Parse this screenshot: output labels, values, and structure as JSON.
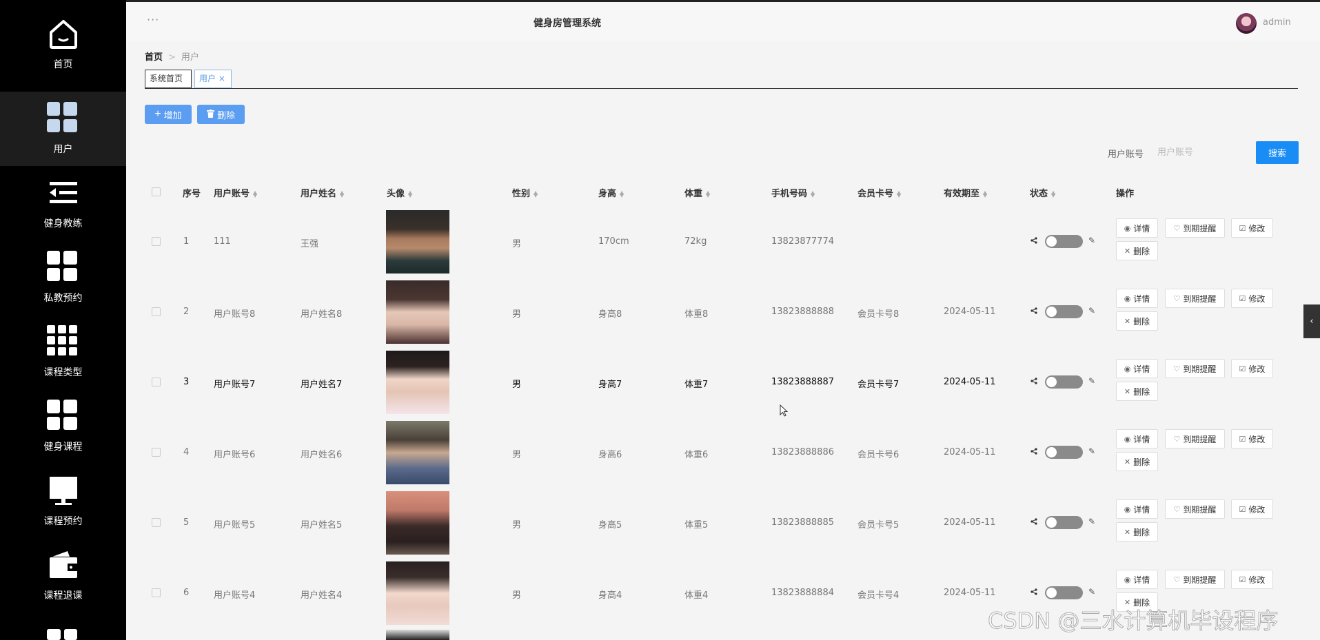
{
  "app": {
    "title": "健身房管理系统",
    "menu_dots": "···",
    "user": "admin"
  },
  "sidebar": {
    "items": [
      {
        "label": "首页",
        "icon": "home-icon"
      },
      {
        "label": "用户",
        "icon": "grid-icon",
        "active": true
      },
      {
        "label": "健身教练",
        "icon": "list-icon"
      },
      {
        "label": "私教预约",
        "icon": "grid-icon"
      },
      {
        "label": "课程类型",
        "icon": "grid9-icon"
      },
      {
        "label": "健身课程",
        "icon": "grid-icon"
      },
      {
        "label": "课程预约",
        "icon": "monitor-icon"
      },
      {
        "label": "课程退课",
        "icon": "wallet-icon"
      }
    ]
  },
  "breadcrumb": {
    "home": "首页",
    "sep": ">",
    "current": "用户"
  },
  "tabs": [
    {
      "label": "系统首页"
    },
    {
      "label": "用户",
      "close": "×"
    }
  ],
  "actions": {
    "add": "增加",
    "delete": "删除"
  },
  "search": {
    "label": "用户账号",
    "placeholder": "用户账号",
    "button": "搜索"
  },
  "table": {
    "headers": {
      "index": "序号",
      "account": "用户账号",
      "name": "用户姓名",
      "avatar": "头像",
      "gender": "性别",
      "height": "身高",
      "weight": "体重",
      "phone": "手机号码",
      "card": "会员卡号",
      "expire": "有效期至",
      "status": "状态",
      "ops": "操作"
    },
    "ops": {
      "detail": "详情",
      "remind": "到期提醒",
      "edit": "修改",
      "delete": "删除"
    },
    "rows": [
      {
        "index": "1",
        "account": "111",
        "name": "王强",
        "gender": "男",
        "height": "170cm",
        "weight": "72kg",
        "phone": "13823877774",
        "card": "",
        "expire": ""
      },
      {
        "index": "2",
        "account": "用户账号8",
        "name": "用户姓名8",
        "gender": "男",
        "height": "身高8",
        "weight": "体重8",
        "phone": "13823888888",
        "card": "会员卡号8",
        "expire": "2024-05-11"
      },
      {
        "index": "3",
        "account": "用户账号7",
        "name": "用户姓名7",
        "gender": "男",
        "height": "身高7",
        "weight": "体重7",
        "phone": "13823888887",
        "card": "会员卡号7",
        "expire": "2024-05-11"
      },
      {
        "index": "4",
        "account": "用户账号6",
        "name": "用户姓名6",
        "gender": "男",
        "height": "身高6",
        "weight": "体重6",
        "phone": "13823888886",
        "card": "会员卡号6",
        "expire": "2024-05-11"
      },
      {
        "index": "5",
        "account": "用户账号5",
        "name": "用户姓名5",
        "gender": "男",
        "height": "身高5",
        "weight": "体重5",
        "phone": "13823888885",
        "card": "会员卡号5",
        "expire": "2024-05-11"
      },
      {
        "index": "6",
        "account": "用户账号4",
        "name": "用户姓名4",
        "gender": "男",
        "height": "身高4",
        "weight": "体重4",
        "phone": "13823888884",
        "card": "会员卡号4",
        "expire": "2024-05-11"
      }
    ]
  },
  "watermark": "CSDN @三水计算机毕设程序",
  "colors": {
    "sidebar": "#000000",
    "primary": "#5b9df0",
    "search": "#1a8cf5"
  }
}
